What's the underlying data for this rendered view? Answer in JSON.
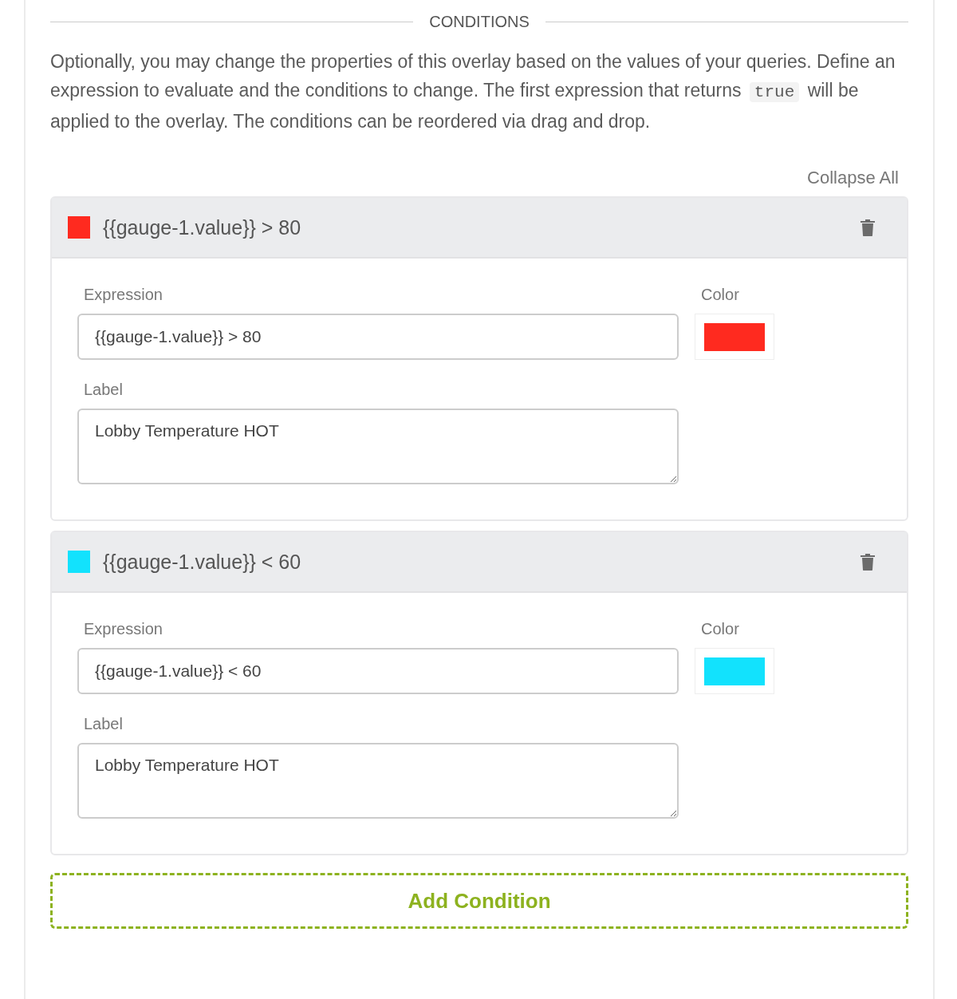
{
  "section_title": "CONDITIONS",
  "description": {
    "before": "Optionally, you may change the properties of this overlay based on the values of your queries. Define an expression to evaluate and the conditions to change. The first expression that returns ",
    "code": "true",
    "after": " will be applied to the overlay. The conditions can be reordered via drag and drop."
  },
  "collapse_all": "Collapse All",
  "conditions": [
    {
      "color": "#ff2a1f",
      "title": "{{gauge-1.value}} > 80",
      "expression_label": "Expression",
      "expression": "{{gauge-1.value}} > 80",
      "color_label": "Color",
      "label_label": "Label",
      "label": "Lobby Temperature HOT"
    },
    {
      "color": "#12e2fd",
      "title": "{{gauge-1.value}} < 60",
      "expression_label": "Expression",
      "expression": "{{gauge-1.value}} < 60",
      "color_label": "Color",
      "label_label": "Label",
      "label": "Lobby Temperature HOT"
    }
  ],
  "add_button": "Add Condition"
}
